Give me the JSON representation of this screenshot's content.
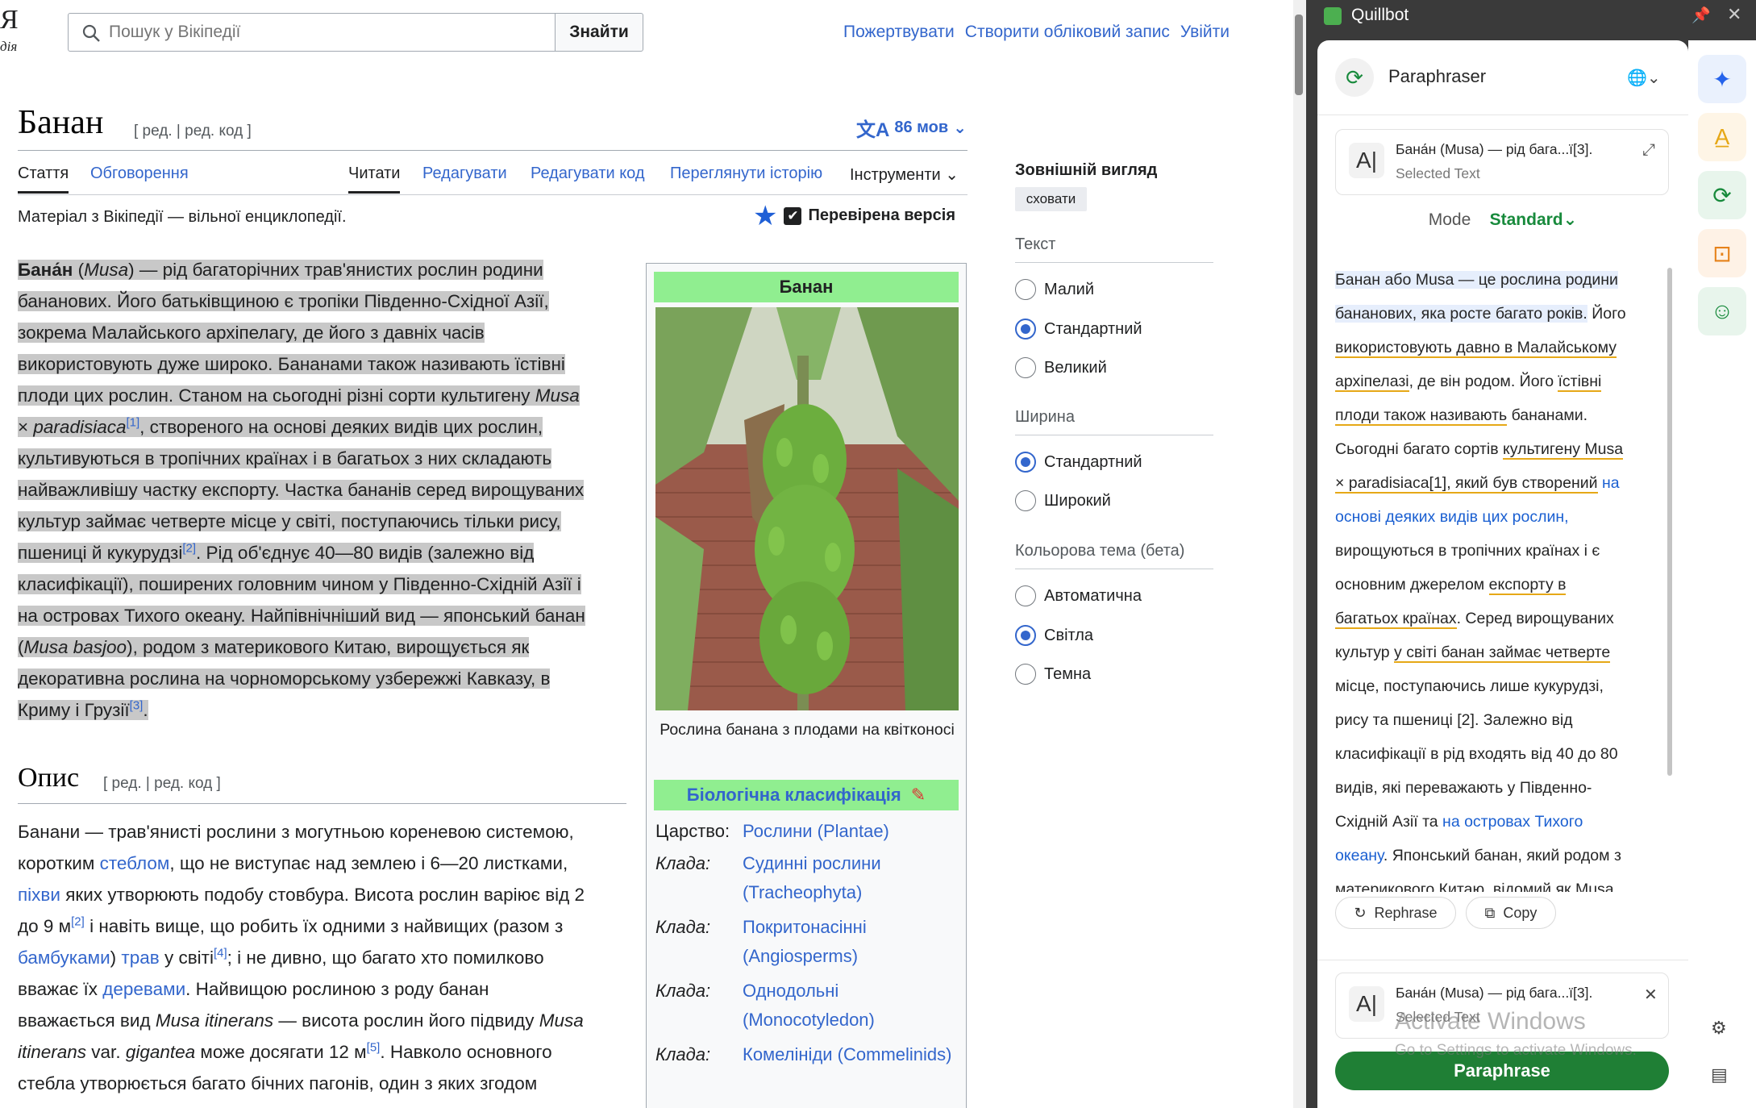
{
  "header": {
    "logo_letter": "Я",
    "logo_sub": "дія",
    "search_placeholder": "Пошук у Вікіпедії",
    "search_button": "Знайти",
    "links": [
      "Пожертвувати",
      "Створити обліковий запис",
      "Увійти"
    ]
  },
  "article": {
    "title": "Банан",
    "edit_links": "[ ред. | ред. код ]",
    "lang_button": "86 мов",
    "tabs_left": [
      "Стаття",
      "Обговорення"
    ],
    "tabs_right": [
      "Читати",
      "Редагувати",
      "Редагувати код",
      "Переглянути історію",
      "Інструменти"
    ],
    "from_wiki": "Матеріал з Вікіпедії — вільної енциклопедії.",
    "verified": "Перевірена версія",
    "section_title": "Опис",
    "section_edit": "[ ред. | ред. код ]"
  },
  "infobox": {
    "title": "Банан",
    "caption": "Рослина банана з плодами на квітконосі",
    "class_title": "Біологічна класифікація",
    "rows": [
      {
        "key": "Царство:",
        "value": "Рослини (Plantae)"
      },
      {
        "key": "Клада:",
        "value": "Судинні рослини (Tracheophyta)"
      },
      {
        "key": "Клада:",
        "value": "Покритонасінні (Angiosperms)"
      },
      {
        "key": "Клада:",
        "value": "Однодольні (Monocotyledon)"
      },
      {
        "key": "Клада:",
        "value": "Комелініди (Commelinids)"
      }
    ]
  },
  "appearance": {
    "title": "Зовнішній вигляд",
    "hide": "сховати",
    "text_heading": "Текст",
    "text_options": [
      "Малий",
      "Стандартний",
      "Великий"
    ],
    "text_selected": "Стандартний",
    "width_heading": "Ширина",
    "width_options": [
      "Стандартний",
      "Широкий"
    ],
    "width_selected": "Стандартний",
    "theme_heading": "Кольорова тема (бета)",
    "theme_options": [
      "Автоматична",
      "Світла",
      "Темна"
    ],
    "theme_selected": "Світла"
  },
  "quillbot": {
    "app_name": "Quillbot",
    "tool_name": "Paraphraser",
    "selected_title": "Бана́н (Musa) — рід бага...ї[3].",
    "selected_sub": "Selected Text",
    "mode_label": "Mode",
    "mode_value": "Standard",
    "rephrase": "Rephrase",
    "copy": "Copy",
    "second_title": "Бана́н (Musa) — рід бага...ї[3].",
    "second_sub": "Selected Text",
    "paraphrase_button": "Paraphrase"
  },
  "watermark": {
    "line1": "Activate Windows",
    "line2": "Go to Settings to activate Windows."
  },
  "colors": {
    "link": "#3366cc",
    "infobox_header": "#90ee90",
    "quillbot_green": "#1f7f35",
    "highlight": "#c8c8c8"
  }
}
